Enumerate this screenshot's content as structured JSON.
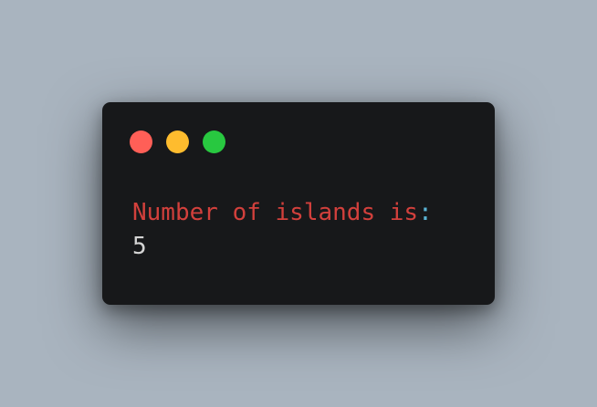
{
  "window": {
    "controls": {
      "close_color": "#ff5f57",
      "minimize_color": "#febc2e",
      "zoom_color": "#28c840",
      "close_icon": "close-dot-icon",
      "minimize_icon": "minimize-dot-icon",
      "zoom_icon": "zoom-dot-icon"
    },
    "output": {
      "message": "Number of islands is",
      "separator": ":",
      "value": "5"
    },
    "colors": {
      "background": "#17181a",
      "message": "#d2403c",
      "separator": "#5ab4d6",
      "value": "#d4d4d4"
    }
  }
}
